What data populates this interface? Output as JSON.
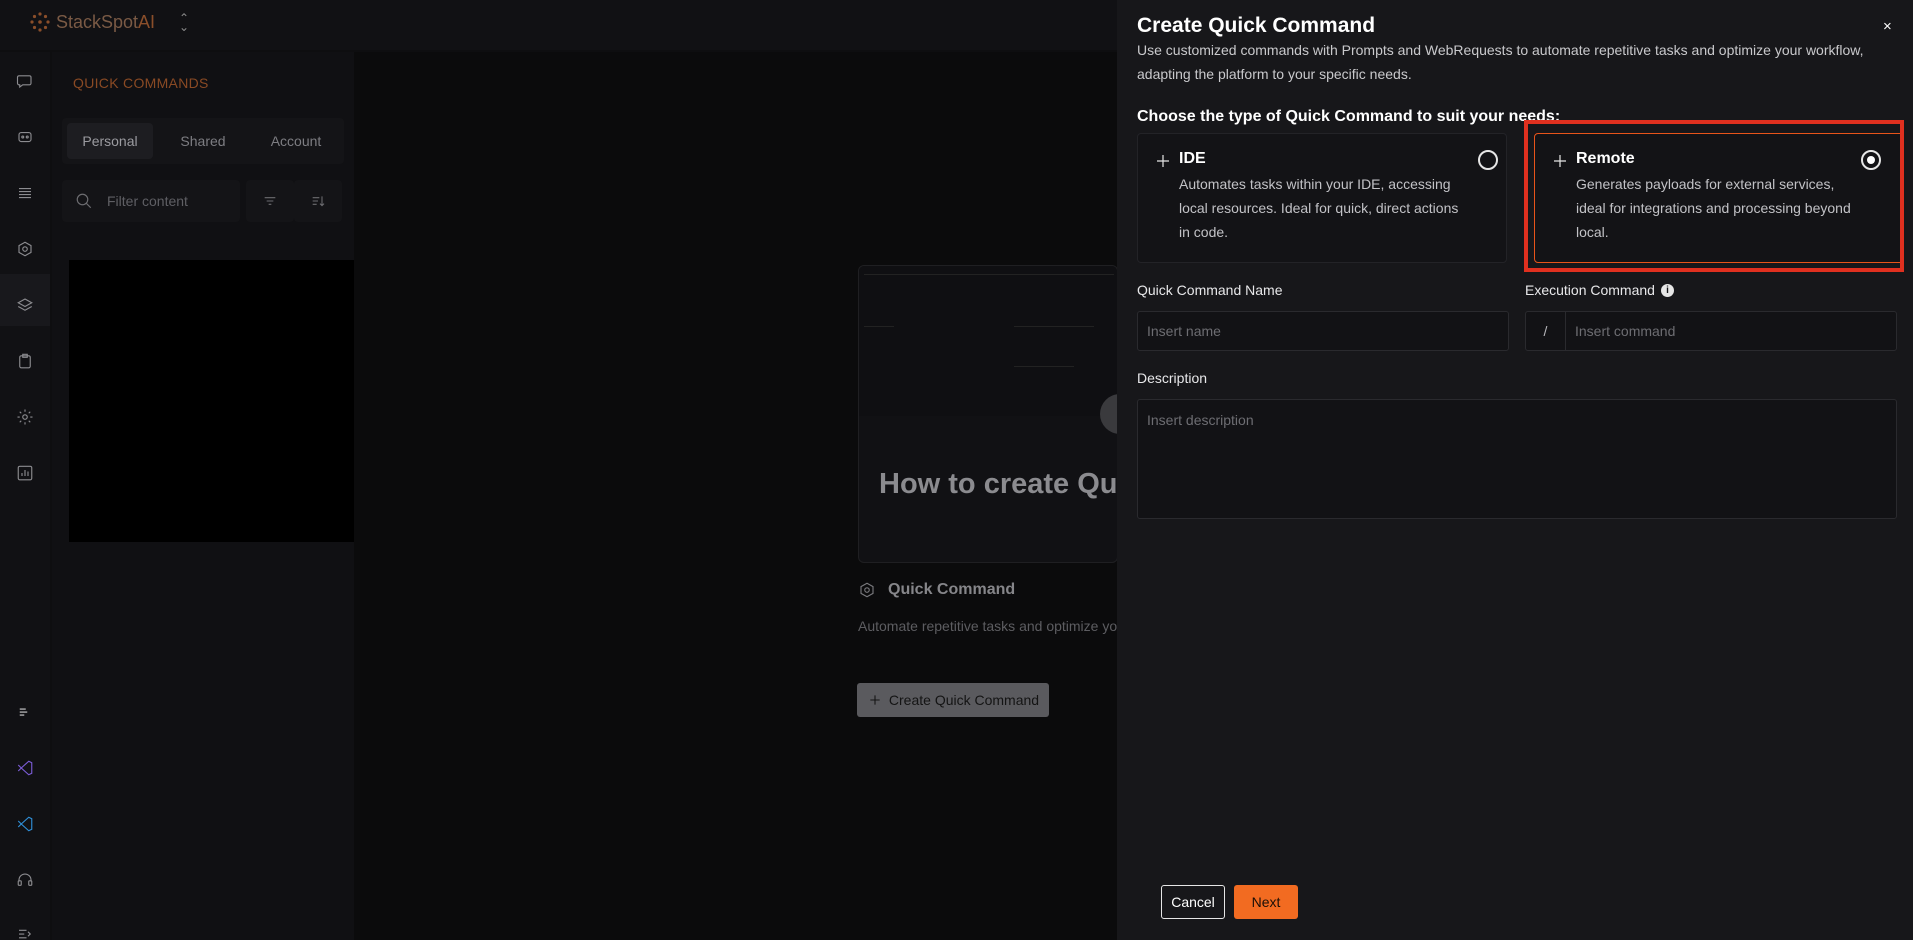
{
  "brand": {
    "name": "StackSpot",
    "suffix": "AI",
    "accent": "#f26b21"
  },
  "rail": {
    "icons": [
      "chat-icon",
      "agent-icon",
      "knowledge-icon",
      "quick-commands-icon",
      "stacks-icon",
      "clipboard-icon",
      "settings-icon",
      "analytics-icon",
      "jetbrains-icon",
      "visual-studio-icon",
      "vscode-icon",
      "support-icon",
      "collapse-icon"
    ]
  },
  "panel": {
    "title": "QUICK COMMANDS",
    "tabs": [
      {
        "label": "Personal",
        "active": true
      },
      {
        "label": "Shared",
        "active": false
      },
      {
        "label": "Account",
        "active": false
      }
    ],
    "filter_placeholder": "Filter content"
  },
  "main": {
    "video_title": "How to create Quick Commands?",
    "qc_heading": "Quick Command",
    "qc_description": "Automate repetitive tasks and optimize your workflow with prompts and web requests, adapting the platform to your needs.",
    "create_button": "Create Quick Command"
  },
  "drawer": {
    "title": "Create Quick Command",
    "close": "×",
    "subtitle": "Use customized commands with Prompts and WebRequests to automate repetitive tasks and optimize your workflow, adapting the platform to your specific needs.",
    "choose_label": "Choose the type of Quick Command to suit your needs:",
    "types": [
      {
        "name": "IDE",
        "description": "Automates tasks within your IDE, accessing local resources. Ideal for quick, direct actions in code.",
        "selected": false
      },
      {
        "name": "Remote",
        "description": "Generates payloads for external services, ideal for integrations and processing beyond local.",
        "selected": true
      }
    ],
    "name_label": "Quick Command Name",
    "name_placeholder": "Insert name",
    "exec_label": "Execution Command",
    "exec_prefix": "/",
    "exec_placeholder": "Insert command",
    "desc_label": "Description",
    "desc_placeholder": "Insert description",
    "cancel": "Cancel",
    "next": "Next"
  }
}
